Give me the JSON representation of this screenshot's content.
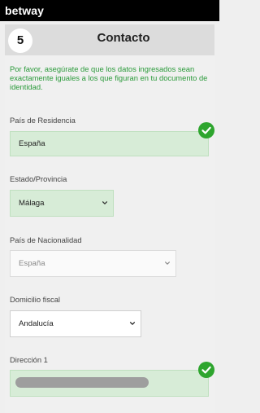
{
  "brand": {
    "logo": "betway"
  },
  "step": {
    "number": "5",
    "title": "Contacto"
  },
  "note": "Por favor, asegúrate de que los datos ingresados sean exactamente iguales a los que figuran en tu documento de identidad.",
  "fields": {
    "residence": {
      "label": "País de Residencia",
      "value": "España"
    },
    "province": {
      "label": "Estado/Provincia",
      "value": "Málaga"
    },
    "nationality": {
      "label": "País de Nacionalidad",
      "value": "España"
    },
    "tax_domicile": {
      "label": "Domicilio fiscal",
      "value": "Andalucía"
    },
    "address1": {
      "label": "Dirección 1"
    }
  },
  "colors": {
    "valid_bg": "#d7ecd7",
    "valid_border": "#bfe0bf",
    "check_green": "#2ea52e",
    "note_green": "#2a9a3a",
    "top_bar": "#000000"
  },
  "icons": [
    "check-circle-icon",
    "chevron-down-icon"
  ]
}
